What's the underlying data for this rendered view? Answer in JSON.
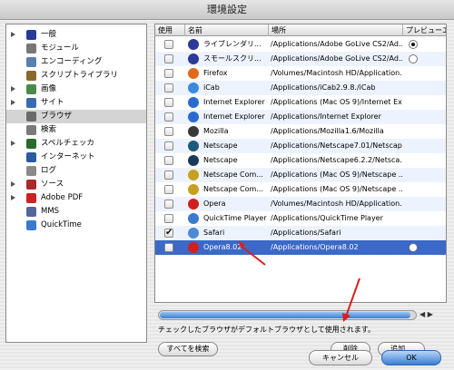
{
  "window": {
    "title": "環境設定"
  },
  "sidebar": {
    "items": [
      {
        "label": "一般",
        "has_disclosure": true,
        "icon": "star-icon",
        "color": "#2a3a9a"
      },
      {
        "label": "モジュール",
        "has_disclosure": false,
        "icon": "gear-icon",
        "color": "#777777"
      },
      {
        "label": "エンコーディング",
        "has_disclosure": false,
        "icon": "document-icon",
        "color": "#5a7fb0"
      },
      {
        "label": "スクリプトライブラリ",
        "has_disclosure": false,
        "icon": "script-icon",
        "color": "#8a6a2a"
      },
      {
        "label": "画像",
        "has_disclosure": true,
        "icon": "image-icon",
        "color": "#4a8a4a"
      },
      {
        "label": "サイト",
        "has_disclosure": true,
        "icon": "site-icon",
        "color": "#3a6ab0"
      },
      {
        "label": "ブラウザ",
        "has_disclosure": false,
        "icon": "browser-icon",
        "color": "#6a6a6a",
        "selected": true
      },
      {
        "label": "検索",
        "has_disclosure": false,
        "icon": "search-icon",
        "color": "#7a7a7a"
      },
      {
        "label": "スペルチェッカ",
        "has_disclosure": true,
        "icon": "spellcheck-icon",
        "color": "#2a6a2a"
      },
      {
        "label": "インターネット",
        "has_disclosure": false,
        "icon": "globe-icon",
        "color": "#2a5aa0"
      },
      {
        "label": "ログ",
        "has_disclosure": false,
        "icon": "log-icon",
        "color": "#8a8a8a"
      },
      {
        "label": "ソース",
        "has_disclosure": true,
        "icon": "source-icon",
        "color": "#aa2a2a"
      },
      {
        "label": "Adobe PDF",
        "has_disclosure": true,
        "icon": "pdf-icon",
        "color": "#cc2222"
      },
      {
        "label": "MMS",
        "has_disclosure": false,
        "icon": "mms-icon",
        "color": "#556699"
      },
      {
        "label": "QuickTime",
        "has_disclosure": false,
        "icon": "quicktime-icon",
        "color": "#3a7ad0"
      }
    ]
  },
  "table": {
    "columns": [
      "使用",
      "名前",
      "場所",
      "プレビューエン"
    ],
    "rows": [
      {
        "checked": false,
        "name": "ライブレンダリ...",
        "location": "/Applications/Adobe GoLive CS2/Ad...",
        "preview": true,
        "preview_on": true,
        "icon": "star-icon",
        "color": "#2a3a9a"
      },
      {
        "checked": false,
        "name": "スモールスクリ...",
        "location": "/Applications/Adobe GoLive CS2/Ad...",
        "preview": true,
        "preview_on": false,
        "icon": "star-icon",
        "color": "#2a3a9a"
      },
      {
        "checked": false,
        "name": "Firefox",
        "location": "/Volumes/Macintosh HD/Application...",
        "preview": false,
        "icon": "firefox-icon",
        "color": "#e06a1a"
      },
      {
        "checked": false,
        "name": "iCab",
        "location": "/Applications/iCab2.9.8./iCab",
        "preview": false,
        "icon": "icab-icon",
        "color": "#3a8ae0"
      },
      {
        "checked": false,
        "name": "Internet Explorer",
        "location": "/Applications (Mac OS 9)/Internet Ex...",
        "preview": false,
        "icon": "ie-icon",
        "color": "#2a6ad0"
      },
      {
        "checked": false,
        "name": "Internet Explorer",
        "location": "/Applications/Internet Explorer",
        "preview": false,
        "icon": "ie-icon",
        "color": "#2a6ad0"
      },
      {
        "checked": false,
        "name": "Mozilla",
        "location": "/Applications/Mozilla1.6/Mozilla",
        "preview": false,
        "icon": "mozilla-icon",
        "color": "#3a3a3a"
      },
      {
        "checked": false,
        "name": "Netscape",
        "location": "/Applications/Netscape7.01/Netscape",
        "preview": false,
        "icon": "netscape-icon",
        "color": "#1a5a7a"
      },
      {
        "checked": false,
        "name": "Netscape",
        "location": "/Applications/Netscape6.2.2/Netsca...",
        "preview": false,
        "icon": "netscape-n-icon",
        "color": "#1a3a5a"
      },
      {
        "checked": false,
        "name": "Netscape Com...",
        "location": "/Applications (Mac OS 9)/Netscape ...",
        "preview": false,
        "icon": "netscape-com-icon",
        "color": "#c8a020"
      },
      {
        "checked": false,
        "name": "Netscape Com...",
        "location": "/Applications (Mac OS 9)/Netscape ...",
        "preview": false,
        "icon": "netscape-com-icon",
        "color": "#c8a020"
      },
      {
        "checked": false,
        "name": "Opera",
        "location": "/Volumes/Macintosh HD/Application...",
        "preview": false,
        "icon": "opera-icon",
        "color": "#d02020"
      },
      {
        "checked": false,
        "name": "QuickTime Player",
        "location": "/Applications/QuickTime Player",
        "preview": false,
        "icon": "quicktime-icon",
        "color": "#3a7ad0"
      },
      {
        "checked": true,
        "name": "Safari",
        "location": "/Applications/Safari",
        "preview": false,
        "icon": "safari-icon",
        "color": "#4a8ad8"
      },
      {
        "checked": false,
        "name": "Opera8.02",
        "location": "/Applications/Opera8.02",
        "preview": true,
        "preview_on": false,
        "icon": "opera-icon",
        "color": "#d02020",
        "selected": true
      }
    ]
  },
  "footer": {
    "note": "チェックしたブラウザがデフォルトブラウザとして使用されます。",
    "search_all": "すべてを検索",
    "delete": "削除",
    "add": "追加...",
    "cancel": "キャンセル",
    "ok": "OK"
  },
  "colors": {
    "selection": "#3a69c7",
    "accent_red": "#d82020"
  }
}
